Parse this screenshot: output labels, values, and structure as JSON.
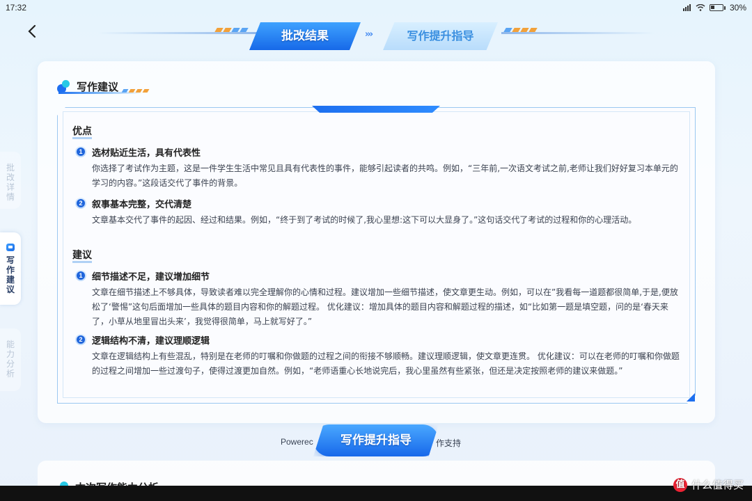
{
  "status_bar": {
    "time": "17:32",
    "battery": "30%"
  },
  "steps": {
    "active": "批改结果",
    "arrows": "›››",
    "inactive": "写作提升指导"
  },
  "side_tabs": [
    {
      "label": "批改详情"
    },
    {
      "label": "写作建议"
    },
    {
      "label": "能力分析"
    }
  ],
  "card": {
    "title": "写作建议",
    "strengths_heading": "优点",
    "strengths": [
      {
        "num": "1",
        "title": "选材贴近生活，具有代表性",
        "body": "你选择了考试作为主题，这是一件学生生活中常见且具有代表性的事件，能够引起读者的共鸣。例如，“三年前,一次语文考试之前,老师让我们好好复习本单元的学习的内容。”这段话交代了事件的背景。"
      },
      {
        "num": "2",
        "title": "叙事基本完整，交代清楚",
        "body": "文章基本交代了事件的起因、经过和结果。例如，“终于到了考试的时候了,我心里想:这下可以大显身了。”这句话交代了考试的过程和你的心理活动。"
      }
    ],
    "suggestions_heading": "建议",
    "suggestions": [
      {
        "num": "1",
        "title": "细节描述不足，建议增加细节",
        "body": "文章在细节描述上不够具体，导致读者难以完全理解你的心情和过程。建议增加一些细节描述，使文章更生动。例如，可以在”我看每一道题都很简单,于是,便放松了‘警惕”这句后面增加一些具体的题目内容和你的解题过程。 优化建议：增加具体的题目内容和解题过程的描述，如“比如第一题是填空题，问的是‘春天来了，小草从地里冒出头来’，我觉得很简单，马上就写好了。”"
      },
      {
        "num": "2",
        "title": "逻辑结构不清，建议理顺逻辑",
        "body": "文章在逻辑结构上有些混乱，特别是在老师的叮嘱和你做题的过程之间的衔接不够顺畅。建议理顺逻辑，使文章更连贯。 优化建议：可以在老师的叮嘱和你做题的过程之间增加一些过渡句子，使得过渡更加自然。例如，“老师语重心长地说完后，我心里虽然有些紧张，但还是决定按照老师的建议来做题。”"
      }
    ]
  },
  "footer": {
    "powered_prefix": "Powerec",
    "powered_suffix": "作支持",
    "cta_label": "写作提升指导"
  },
  "second_card": {
    "title": "本次写作能力分析"
  },
  "watermark": {
    "logo": "值",
    "text": "什么值得买"
  }
}
